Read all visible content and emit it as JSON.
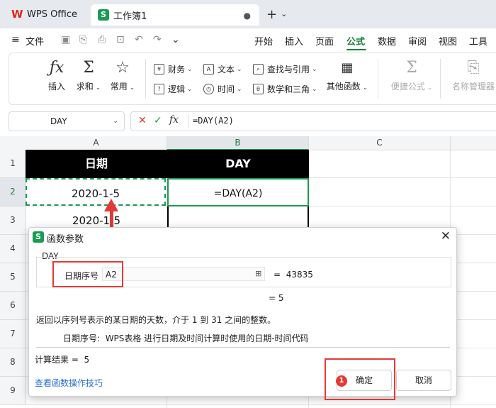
{
  "titlebar": {
    "app_tab": "WPS Office",
    "doc_tab": "工作簿1",
    "doc_tab_dot": "●",
    "new_tab": "+",
    "new_tab_menu": "⌄"
  },
  "menubar": {
    "file": "文件",
    "menu_icon": "≡",
    "tabs": [
      "开始",
      "插入",
      "页面",
      "公式",
      "数据",
      "审阅",
      "视图",
      "工具"
    ],
    "active_tab": "公式"
  },
  "ribbon": {
    "insert": "插入",
    "sum": "求和",
    "common": "常用",
    "finance": "财务",
    "logic": "逻辑",
    "text": "文本",
    "time": "时间",
    "lookup": "查找与引用",
    "math": "数学和三角",
    "other": "其他函数",
    "quick_formula": "便捷公式",
    "name_manager": "名称管理器"
  },
  "formulabar": {
    "name_box": "DAY",
    "cancel": "✕",
    "confirm": "✓",
    "fx": "fx",
    "formula": "=DAY(A2)"
  },
  "sheet": {
    "columns": [
      "A",
      "B",
      "C"
    ],
    "rows": [
      "1",
      "2",
      "3",
      "4",
      "5",
      "6",
      "7",
      "8",
      "9"
    ],
    "header_date": "日期",
    "header_day": "DAY",
    "a2": "2020-1-5",
    "b2": "=DAY(A2)",
    "a3": "2020-1-5"
  },
  "dialog": {
    "title": "函数参数",
    "close": "✕",
    "function_name": "DAY",
    "arg_label": "日期序号",
    "arg_value": "A2",
    "arg_eq": "=",
    "arg_eval": "43835",
    "result_line": "= 5",
    "description": "返回以序列号表示的某日期的天数，介于 1 到 31 之间的整数。",
    "arg_desc_label": "日期序号:",
    "arg_desc_text": "WPS表格 进行日期及时间计算时使用的日期-时间代码",
    "calc_result_label": "计算结果 =",
    "calc_result": "5",
    "link": "查看函数操作技巧",
    "ok": "确定",
    "cancel": "取消",
    "step_badge": "1"
  },
  "colors": {
    "accent_green": "#1a9b52",
    "annotation_red": "#e53935",
    "header_black": "#000000"
  }
}
